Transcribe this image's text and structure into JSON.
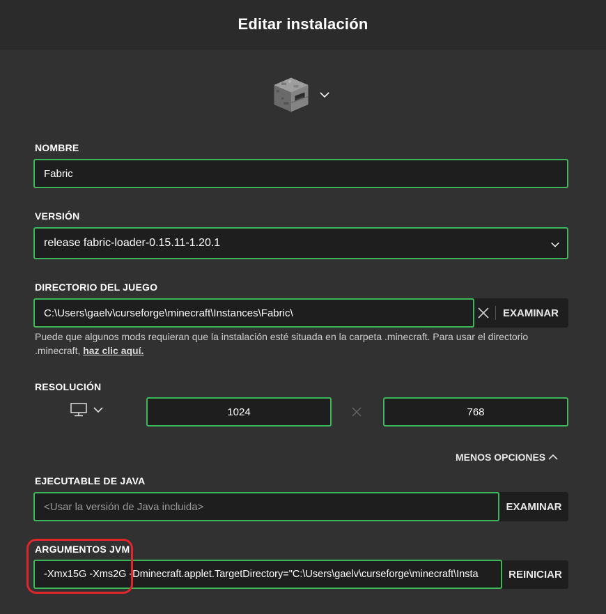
{
  "header": {
    "title": "Editar instalación"
  },
  "icon_picker": {
    "icon": "furnace-icon",
    "chevron": "chevron-down-icon"
  },
  "name": {
    "label": "NOMBRE",
    "value": "Fabric"
  },
  "version": {
    "label": "VERSIÓN",
    "value": "release fabric-loader-0.15.11-1.20.1"
  },
  "game_dir": {
    "label": "DIRECTORIO DEL JUEGO",
    "value": "C:\\Users\\gaelv\\curseforge\\minecraft\\Instances\\Fabric\\",
    "browse_label": "EXAMINAR",
    "hint": "Puede que algunos mods requieran que la instalación esté situada en la carpeta .minecraft. Para usar el directorio .minecraft, ",
    "hint_link": "haz clic aquí."
  },
  "resolution": {
    "label": "RESOLUCIÓN",
    "width": "1024",
    "height": "768"
  },
  "less_options": {
    "label": "MENOS OPCIONES"
  },
  "java_exec": {
    "label": "EJECUTABLE DE JAVA",
    "placeholder": "<Usar la versión de Java incluida>",
    "browse_label": "EXAMINAR"
  },
  "jvm_args": {
    "label": "ARGUMENTOS JVM",
    "value": "-Xmx15G -Xms2G -Dminecraft.applet.TargetDirectory=\"C:\\Users\\gaelv\\curseforge\\minecraft\\Insta",
    "reset_label": "REINICIAR"
  },
  "colors": {
    "accent": "#3fb55a",
    "background": "#313131",
    "field": "#1e1e1e",
    "highlight": "#e0262c"
  }
}
